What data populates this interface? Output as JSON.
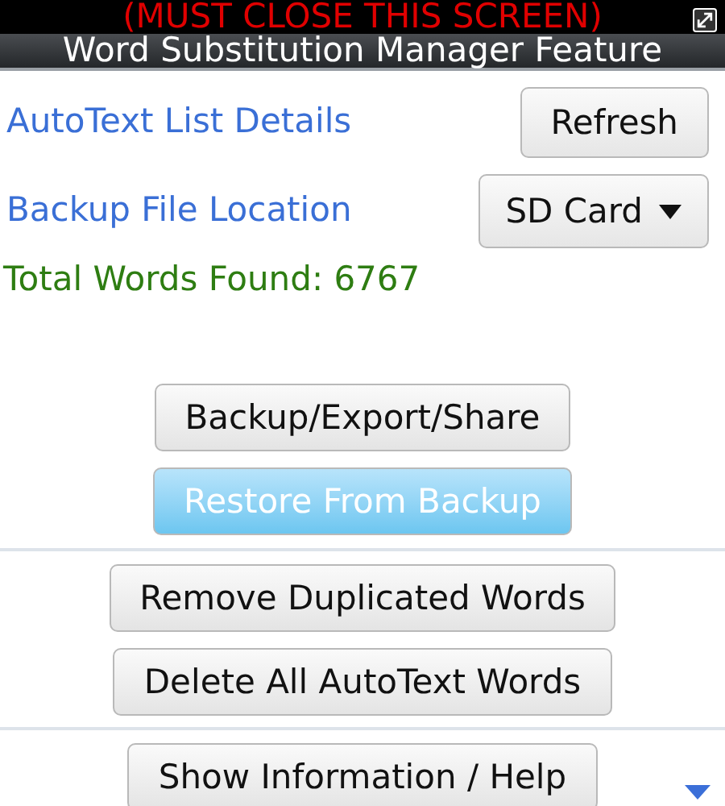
{
  "banner": {
    "text": "(MUST CLOSE THIS SCREEN)"
  },
  "title_bar": {
    "title": "Word Substitution Manager Feature"
  },
  "settings": [
    {
      "label": "AutoText List Details",
      "control": "Refresh",
      "kind": "button"
    },
    {
      "label": "Backup File Location",
      "control": "SD Card",
      "kind": "dropdown"
    }
  ],
  "total_words": "Total Words Found: 6767",
  "button_groups": [
    [
      {
        "label": "Backup/Export/Share",
        "focused": false
      },
      {
        "label": "Restore From Backup",
        "focused": true
      }
    ],
    [
      {
        "label": "Remove Duplicated Words",
        "focused": false
      },
      {
        "label": "Delete All AutoText Words",
        "focused": false
      }
    ],
    [
      {
        "label": "Show Information / Help",
        "focused": false
      }
    ]
  ]
}
